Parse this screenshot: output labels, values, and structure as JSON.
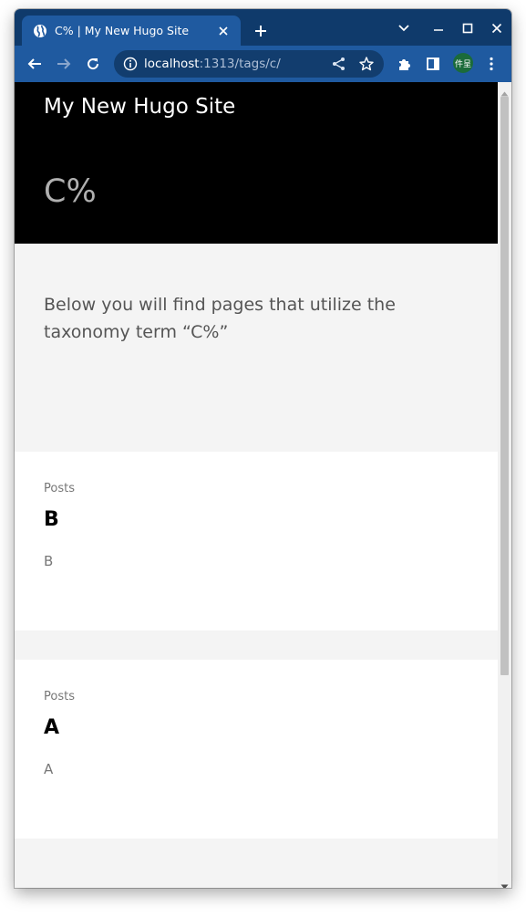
{
  "browser": {
    "tab_title": "C% | My New Hugo Site",
    "url_host": "localhost",
    "url_path": ":1313/tags/c/",
    "profile_initials": "件呈",
    "colors": {
      "tabstrip": "#0f3a6b",
      "toolbar": "#1f5aa0",
      "omnibox": "#123d6e"
    },
    "icons": [
      "globe-icon",
      "close-icon",
      "plus-icon",
      "chevron-down-icon",
      "minimize-icon",
      "maximize-icon",
      "window-close-icon",
      "back-arrow-icon",
      "forward-arrow-icon",
      "reload-icon",
      "info-icon",
      "share-icon",
      "star-icon",
      "puzzle-icon",
      "sidepanel-icon",
      "kebab-menu-icon"
    ]
  },
  "page": {
    "site_title": "My New Hugo Site",
    "heading": "C%",
    "intro": "Below you will find pages that utilize the taxonomy term “C%”",
    "posts": [
      {
        "section": "Posts",
        "title": "B",
        "summary": "B"
      },
      {
        "section": "Posts",
        "title": "A",
        "summary": "A"
      }
    ]
  }
}
